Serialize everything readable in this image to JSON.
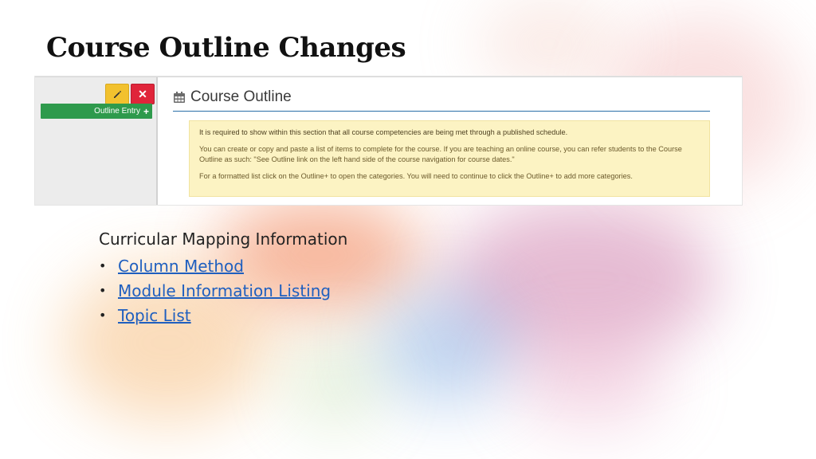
{
  "slide": {
    "title": "Course Outline Changes"
  },
  "screenshot": {
    "outline_entry_label": "Outline Entry",
    "course_outline_heading": "Course Outline",
    "notice": {
      "line1": "It is required to show within this section that all course competencies are being met through a published schedule.",
      "line2": "You can create or copy and paste a list of items to complete for the course. If you are teaching an online course, you can refer students to the Course Outline as such: \"See Outline link on the left hand side of the course navigation for course dates.\"",
      "line3": "For a formatted list click on the Outline+ to open the categories. You will need to continue to click the Outline+ to add more categories."
    },
    "icons": {
      "edit": "pencil-icon",
      "close": "close-icon",
      "add": "plus-icon",
      "calendar": "calendar-icon"
    },
    "colors": {
      "edit_button": "#f2c12e",
      "close_button": "#e0253a",
      "outline_entry_button": "#2e9a4c",
      "notice_background": "#fcf3c3",
      "header_rule": "#2a6fa8"
    }
  },
  "mapping": {
    "title": "Curricular Mapping Information",
    "links": [
      {
        "label": "Column Method"
      },
      {
        "label": "Module Information Listing"
      },
      {
        "label": "Topic List"
      }
    ],
    "bullet": "•",
    "link_color": "#1f5fbf"
  }
}
